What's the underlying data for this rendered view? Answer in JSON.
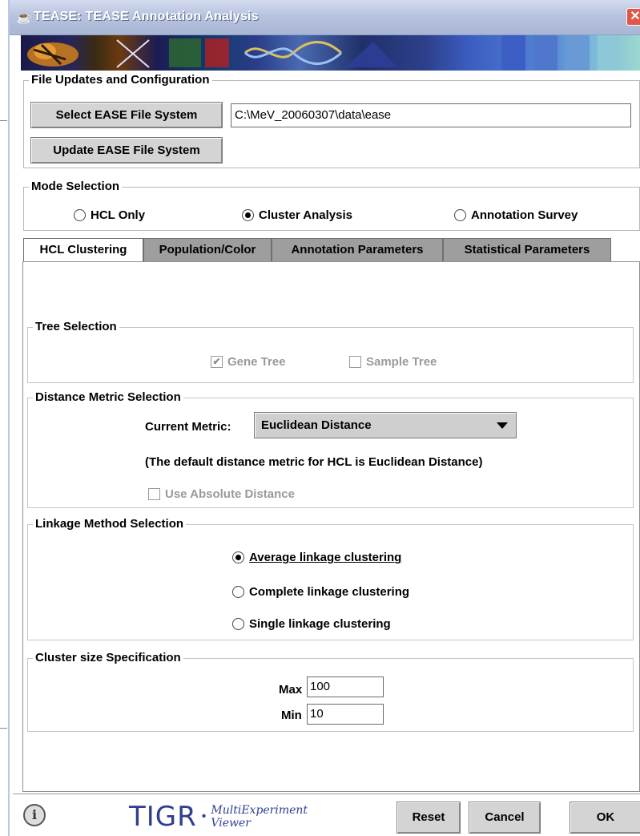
{
  "window": {
    "title": "TEASE: TEASE Annotation Analysis",
    "close_symbol": "✕",
    "app_icon": "java-cup-icon"
  },
  "file_section": {
    "title": "File Updates and Configuration",
    "select_button": "Select EASE File System",
    "update_button": "Update EASE File System",
    "path_value": "C:\\MeV_20060307\\data\\ease"
  },
  "mode_section": {
    "title": "Mode Selection",
    "options": [
      {
        "label": "HCL Only",
        "selected": false
      },
      {
        "label": "Cluster Analysis",
        "selected": true
      },
      {
        "label": "Annotation Survey",
        "selected": false
      }
    ]
  },
  "tabs": [
    {
      "label": "HCL Clustering",
      "active": true
    },
    {
      "label": "Population/Color",
      "active": false
    },
    {
      "label": "Annotation Parameters",
      "active": false
    },
    {
      "label": "Statistical Parameters",
      "active": false
    }
  ],
  "tree_section": {
    "title": "Tree Selection",
    "gene_tree": {
      "label": "Gene Tree",
      "checked": true,
      "enabled": false
    },
    "sample_tree": {
      "label": "Sample Tree",
      "checked": false,
      "enabled": false
    }
  },
  "distance_section": {
    "title": "Distance Metric Selection",
    "metric_label": "Current Metric:",
    "metric_value": "Euclidean Distance",
    "note": "(The default distance metric for HCL is Euclidean Distance)",
    "absolute_label": "Use Absolute Distance",
    "absolute_checked": false
  },
  "linkage_section": {
    "title": "Linkage Method Selection",
    "options": [
      {
        "label": "Average linkage clustering",
        "selected": true
      },
      {
        "label": "Complete linkage clustering",
        "selected": false
      },
      {
        "label": "Single linkage clustering",
        "selected": false
      }
    ]
  },
  "cluster_size_section": {
    "title": "Cluster size Specification",
    "max_label": "Max",
    "max_value": "100",
    "min_label": "Min",
    "min_value": "10"
  },
  "footer": {
    "info_symbol": "i",
    "logo_main": "TIGR",
    "logo_sub1": "MultiExperiment",
    "logo_sub2": "Viewer",
    "reset_button": "Reset",
    "cancel_button": "Cancel",
    "ok_button": "OK"
  }
}
